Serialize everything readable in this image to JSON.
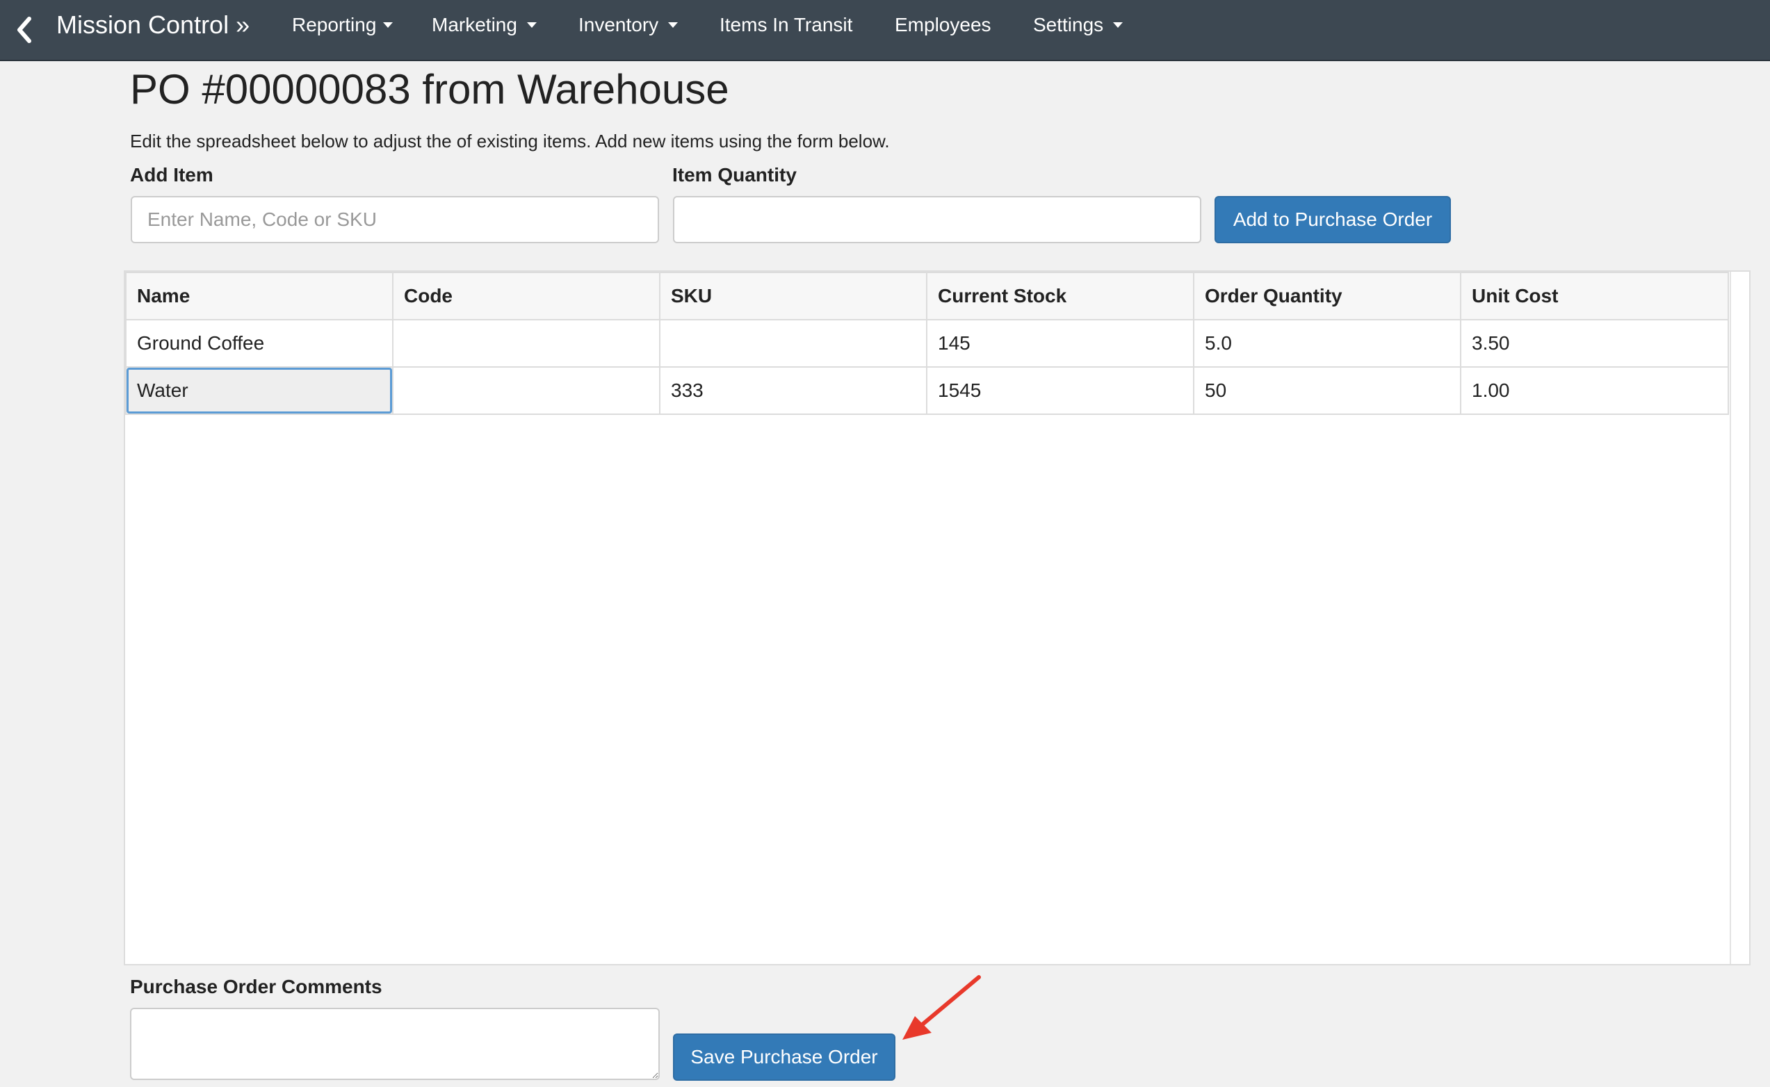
{
  "navbar": {
    "brand": "Mission Control »",
    "items": [
      {
        "label": "Reporting",
        "has_caret": true
      },
      {
        "label": "Marketing",
        "has_caret": true
      },
      {
        "label": "Inventory",
        "has_caret": true
      },
      {
        "label": "Items In Transit",
        "has_caret": false
      },
      {
        "label": "Employees",
        "has_caret": false
      },
      {
        "label": "Settings",
        "has_caret": true
      }
    ],
    "back_icon": "chevron-left-icon",
    "colors": {
      "background": "#3d4852",
      "text": "#ffffff"
    }
  },
  "page": {
    "title": "PO #00000083 from Warehouse",
    "help_text": "Edit the spreadsheet below to adjust the of existing items. Add new items using the form below."
  },
  "add_form": {
    "item_label": "Add Item",
    "item_placeholder": "Enter Name, Code or SKU",
    "item_value": "",
    "quantity_label": "Item Quantity",
    "quantity_value": "",
    "add_button_label": "Add to Purchase Order"
  },
  "grid": {
    "columns": [
      "Name",
      "Code",
      "SKU",
      "Current Stock",
      "Order Quantity",
      "Unit Cost"
    ],
    "rows": [
      [
        "Ground Coffee",
        "",
        "",
        "145",
        "5.0",
        "3.50"
      ],
      [
        "Water",
        "",
        "333",
        "1545",
        "50",
        "1.00"
      ]
    ],
    "selected_cell": {
      "row": 1,
      "column": 0
    }
  },
  "comments": {
    "label": "Purchase Order Comments",
    "value": ""
  },
  "save_button_label": "Save Purchase Order",
  "colors": {
    "primary_button": "#337ab7",
    "annotation_arrow": "#e8392b",
    "page_background": "#f1f1f1"
  }
}
